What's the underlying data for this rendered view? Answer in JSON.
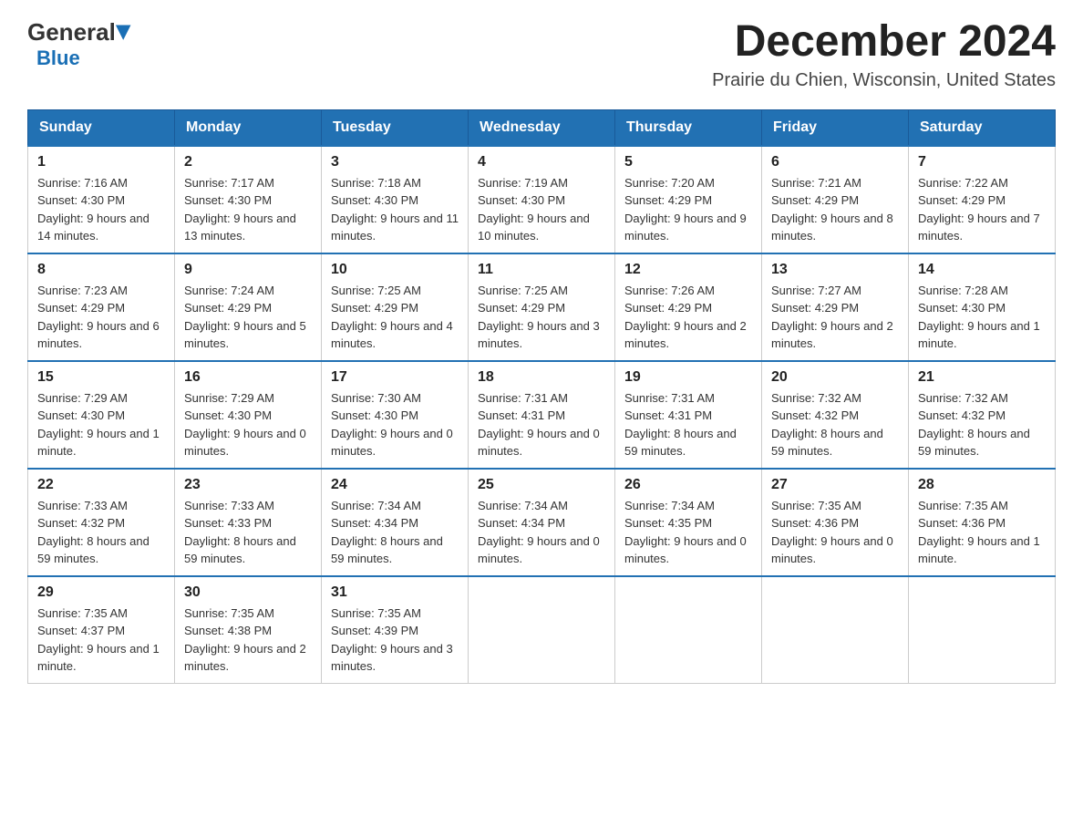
{
  "header": {
    "logo_general": "General",
    "logo_blue": "Blue",
    "month_title": "December 2024",
    "location": "Prairie du Chien, Wisconsin, United States"
  },
  "weekdays": [
    "Sunday",
    "Monday",
    "Tuesday",
    "Wednesday",
    "Thursday",
    "Friday",
    "Saturday"
  ],
  "weeks": [
    [
      {
        "day": "1",
        "sunrise": "7:16 AM",
        "sunset": "4:30 PM",
        "daylight": "9 hours and 14 minutes."
      },
      {
        "day": "2",
        "sunrise": "7:17 AM",
        "sunset": "4:30 PM",
        "daylight": "9 hours and 13 minutes."
      },
      {
        "day": "3",
        "sunrise": "7:18 AM",
        "sunset": "4:30 PM",
        "daylight": "9 hours and 11 minutes."
      },
      {
        "day": "4",
        "sunrise": "7:19 AM",
        "sunset": "4:30 PM",
        "daylight": "9 hours and 10 minutes."
      },
      {
        "day": "5",
        "sunrise": "7:20 AM",
        "sunset": "4:29 PM",
        "daylight": "9 hours and 9 minutes."
      },
      {
        "day": "6",
        "sunrise": "7:21 AM",
        "sunset": "4:29 PM",
        "daylight": "9 hours and 8 minutes."
      },
      {
        "day": "7",
        "sunrise": "7:22 AM",
        "sunset": "4:29 PM",
        "daylight": "9 hours and 7 minutes."
      }
    ],
    [
      {
        "day": "8",
        "sunrise": "7:23 AM",
        "sunset": "4:29 PM",
        "daylight": "9 hours and 6 minutes."
      },
      {
        "day": "9",
        "sunrise": "7:24 AM",
        "sunset": "4:29 PM",
        "daylight": "9 hours and 5 minutes."
      },
      {
        "day": "10",
        "sunrise": "7:25 AM",
        "sunset": "4:29 PM",
        "daylight": "9 hours and 4 minutes."
      },
      {
        "day": "11",
        "sunrise": "7:25 AM",
        "sunset": "4:29 PM",
        "daylight": "9 hours and 3 minutes."
      },
      {
        "day": "12",
        "sunrise": "7:26 AM",
        "sunset": "4:29 PM",
        "daylight": "9 hours and 2 minutes."
      },
      {
        "day": "13",
        "sunrise": "7:27 AM",
        "sunset": "4:29 PM",
        "daylight": "9 hours and 2 minutes."
      },
      {
        "day": "14",
        "sunrise": "7:28 AM",
        "sunset": "4:30 PM",
        "daylight": "9 hours and 1 minute."
      }
    ],
    [
      {
        "day": "15",
        "sunrise": "7:29 AM",
        "sunset": "4:30 PM",
        "daylight": "9 hours and 1 minute."
      },
      {
        "day": "16",
        "sunrise": "7:29 AM",
        "sunset": "4:30 PM",
        "daylight": "9 hours and 0 minutes."
      },
      {
        "day": "17",
        "sunrise": "7:30 AM",
        "sunset": "4:30 PM",
        "daylight": "9 hours and 0 minutes."
      },
      {
        "day": "18",
        "sunrise": "7:31 AM",
        "sunset": "4:31 PM",
        "daylight": "9 hours and 0 minutes."
      },
      {
        "day": "19",
        "sunrise": "7:31 AM",
        "sunset": "4:31 PM",
        "daylight": "8 hours and 59 minutes."
      },
      {
        "day": "20",
        "sunrise": "7:32 AM",
        "sunset": "4:32 PM",
        "daylight": "8 hours and 59 minutes."
      },
      {
        "day": "21",
        "sunrise": "7:32 AM",
        "sunset": "4:32 PM",
        "daylight": "8 hours and 59 minutes."
      }
    ],
    [
      {
        "day": "22",
        "sunrise": "7:33 AM",
        "sunset": "4:32 PM",
        "daylight": "8 hours and 59 minutes."
      },
      {
        "day": "23",
        "sunrise": "7:33 AM",
        "sunset": "4:33 PM",
        "daylight": "8 hours and 59 minutes."
      },
      {
        "day": "24",
        "sunrise": "7:34 AM",
        "sunset": "4:34 PM",
        "daylight": "8 hours and 59 minutes."
      },
      {
        "day": "25",
        "sunrise": "7:34 AM",
        "sunset": "4:34 PM",
        "daylight": "9 hours and 0 minutes."
      },
      {
        "day": "26",
        "sunrise": "7:34 AM",
        "sunset": "4:35 PM",
        "daylight": "9 hours and 0 minutes."
      },
      {
        "day": "27",
        "sunrise": "7:35 AM",
        "sunset": "4:36 PM",
        "daylight": "9 hours and 0 minutes."
      },
      {
        "day": "28",
        "sunrise": "7:35 AM",
        "sunset": "4:36 PM",
        "daylight": "9 hours and 1 minute."
      }
    ],
    [
      {
        "day": "29",
        "sunrise": "7:35 AM",
        "sunset": "4:37 PM",
        "daylight": "9 hours and 1 minute."
      },
      {
        "day": "30",
        "sunrise": "7:35 AM",
        "sunset": "4:38 PM",
        "daylight": "9 hours and 2 minutes."
      },
      {
        "day": "31",
        "sunrise": "7:35 AM",
        "sunset": "4:39 PM",
        "daylight": "9 hours and 3 minutes."
      },
      null,
      null,
      null,
      null
    ]
  ],
  "labels": {
    "sunrise": "Sunrise:",
    "sunset": "Sunset:",
    "daylight": "Daylight:"
  }
}
